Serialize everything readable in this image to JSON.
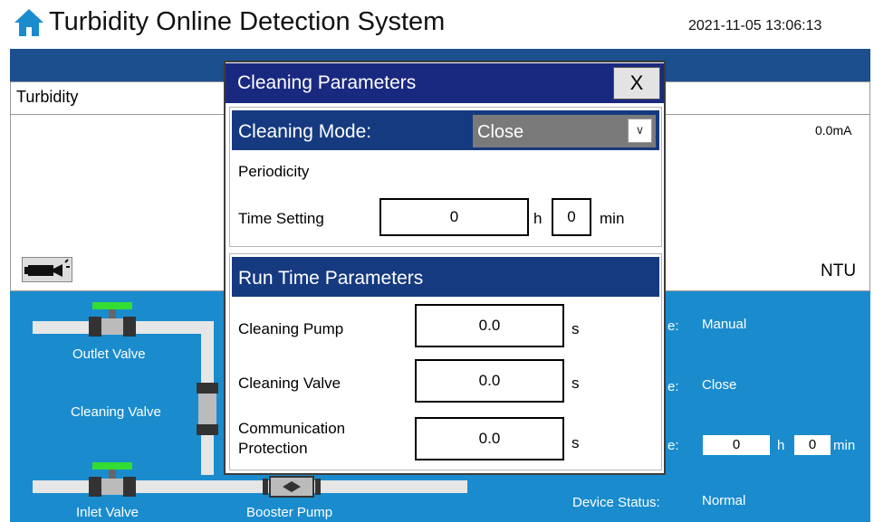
{
  "header": {
    "title": "Turbidity Online Detection System",
    "datetime": "2021-11-05 13:06:13",
    "home_icon": "home-icon"
  },
  "turbidity_panel": {
    "label": "Turbidity",
    "current_value": "0.0mA",
    "unit": "NTU",
    "camera_icon": "camera-icon"
  },
  "process": {
    "outlet_valve": "Outlet Valve",
    "cleaning_valve": "Cleaning Valve",
    "inlet_valve": "Inlet Valve",
    "booster_pump": "Booster Pump",
    "mode_label_fragment": "e:",
    "mode_value": "Manual",
    "cleaning_label_fragment": "e:",
    "cleaning_value": "Close",
    "time_label_fragment": "e:",
    "time_hours": "0",
    "time_h_unit": "h",
    "time_minutes": "0",
    "time_min_unit": "min",
    "device_status_label": "Device Status:",
    "device_status_value": "Normal",
    "colors": {
      "background": "#1a8cce",
      "valve_cap": "#33dd33"
    }
  },
  "modal": {
    "title": "Cleaning Parameters",
    "close_label": "X",
    "cleaning_mode_label": "Cleaning Mode:",
    "cleaning_mode_value": "Close",
    "periodicity_label": "Periodicity",
    "time_setting_label": "Time Setting",
    "time_hours": "0",
    "hours_unit": "h",
    "time_minutes": "0",
    "minutes_unit": "min",
    "run_time_title": "Run Time Parameters",
    "params": [
      {
        "label": "Cleaning Pump",
        "value": "0.0",
        "unit": "s"
      },
      {
        "label": "Cleaning Valve",
        "value": "0.0",
        "unit": "s"
      },
      {
        "label": "Communication\nProtection",
        "value": "0.0",
        "unit": "s"
      }
    ],
    "colors": {
      "titlebar": "#1a2980",
      "section_header": "#163a80"
    }
  }
}
